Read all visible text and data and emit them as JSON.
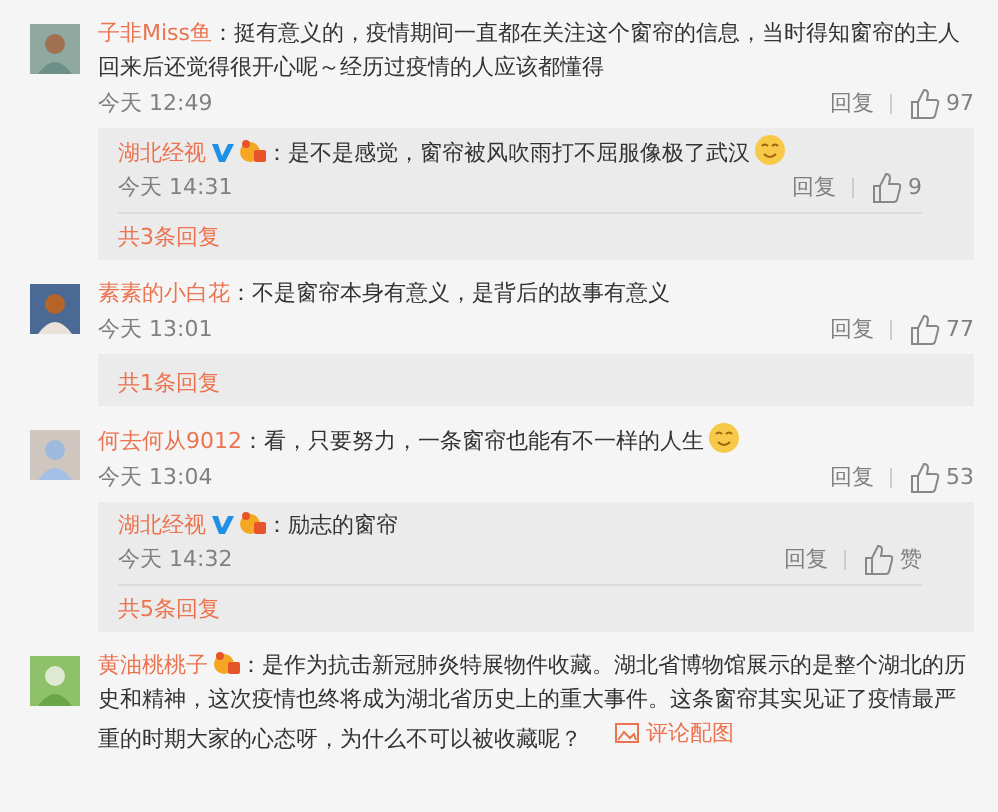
{
  "comments": [
    {
      "name": "子非Miss鱼",
      "text": "：挺有意义的，疫情期间一直都在关注这个窗帘的信息，当时得知窗帘的主人回来后还觉得很开心呢～经历过疫情的人应该都懂得",
      "emoji": false,
      "time": "今天 12:49",
      "reply_label": "回复",
      "likes": "97",
      "replies": [
        {
          "name": "湖北经视",
          "badges": [
            {
              "kind": "verified"
            },
            {
              "kind": "member"
            }
          ],
          "text": "：是不是感觉，窗帘被风吹雨打不屈服像极了武汉",
          "emoji": true,
          "time": "今天 14:31",
          "reply_label": "回复",
          "likes": "9"
        }
      ],
      "more": "共3条回复"
    },
    {
      "name": "素素的小白花",
      "text": "：不是窗帘本身有意义，是背后的故事有意义",
      "emoji": false,
      "time": "今天 13:01",
      "reply_label": "回复",
      "likes": "77",
      "more": "共1条回复"
    },
    {
      "name": "何去何从9012",
      "text": "：看，只要努力，一条窗帘也能有不一样的人生",
      "emoji": true,
      "time": "今天 13:04",
      "reply_label": "回复",
      "likes": "53",
      "replies": [
        {
          "name": "湖北经视",
          "badges": [
            {
              "kind": "verified"
            },
            {
              "kind": "member"
            }
          ],
          "text": "：励志的窗帘",
          "emoji": false,
          "time": "今天 14:32",
          "reply_label": "回复",
          "likes": "赞"
        }
      ],
      "more": "共5条回复"
    },
    {
      "name": "黄油桃桃子",
      "badges": [
        {
          "kind": "member"
        }
      ],
      "text": "：是作为抗击新冠肺炎特展物件收藏。湖北省博物馆展示的是整个湖北的历史和精神，这次疫情也终将成为湖北省历史上的重大事件。这条窗帘其实见证了疫情最严重的时期大家的心态呀，为什么不可以被收藏呢？",
      "emoji": false,
      "attachment": "评论配图"
    }
  ]
}
